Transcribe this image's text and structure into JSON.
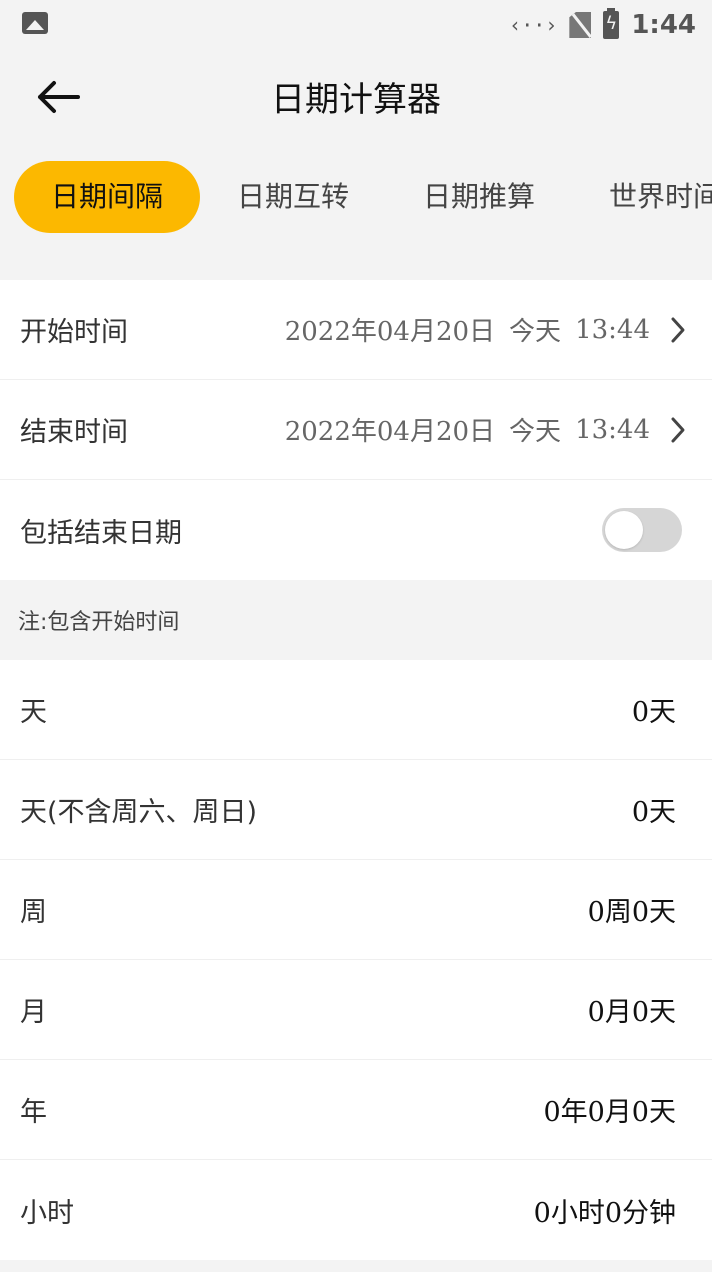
{
  "status_bar": {
    "left_icon": "image-icon",
    "signal_text": "‹··›",
    "time": "1:44"
  },
  "header": {
    "title": "日期计算器",
    "back_icon": "arrow-left-icon"
  },
  "tabs": [
    {
      "label": "日期间隔",
      "active": true
    },
    {
      "label": "日期互转",
      "active": false
    },
    {
      "label": "日期推算",
      "active": false
    },
    {
      "label": "世界时间",
      "active": false
    }
  ],
  "settings": {
    "start": {
      "label": "开始时间",
      "date": "2022年04月20日",
      "today": "今天",
      "time": "13:44"
    },
    "end": {
      "label": "结束时间",
      "date": "2022年04月20日",
      "today": "今天",
      "time": "13:44"
    },
    "include_end": {
      "label": "包括结束日期",
      "on": false
    }
  },
  "note": "注:包含开始时间",
  "results": [
    {
      "label": "天",
      "value": "0天"
    },
    {
      "label": "天(不含周六、周日)",
      "value": "0天"
    },
    {
      "label": "周",
      "value": "0周0天"
    },
    {
      "label": "月",
      "value": "0月0天"
    },
    {
      "label": "年",
      "value": "0年0月0天"
    },
    {
      "label": "小时",
      "value": "0小时0分钟"
    }
  ],
  "colors": {
    "accent": "#fcb800",
    "background": "#f3f3f3",
    "toggle_off": "#d6d6d6"
  }
}
